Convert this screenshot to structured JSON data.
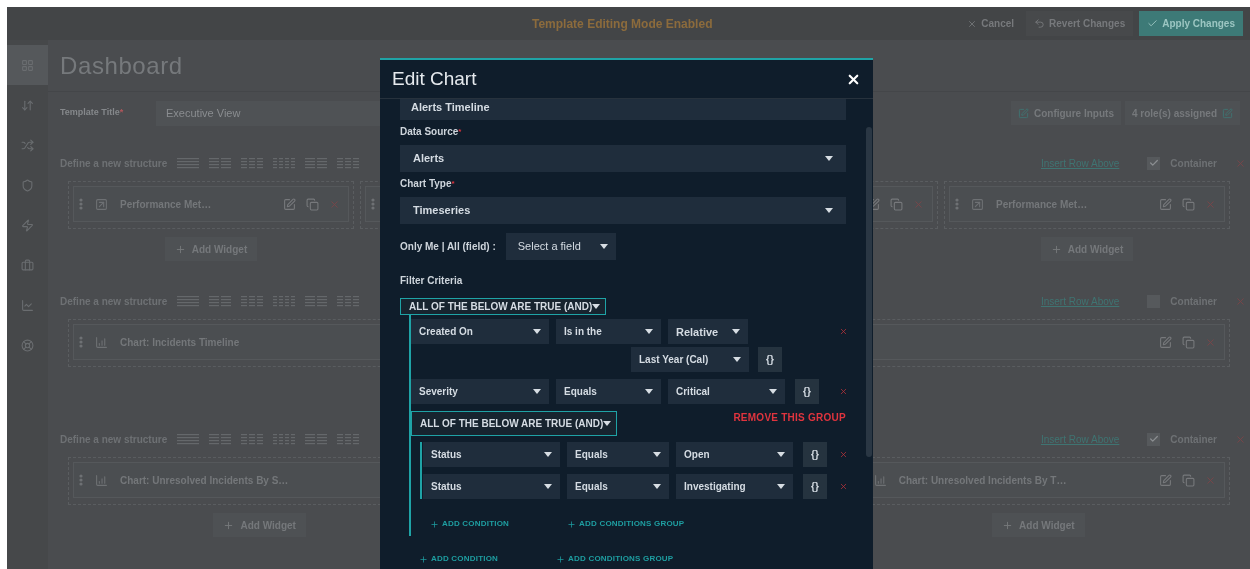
{
  "top_bar": {
    "title": "Template Editing Mode Enabled",
    "actions": [
      {
        "kind": "cancel",
        "label": "Cancel"
      },
      {
        "kind": "revert",
        "label": "Revert Changes"
      },
      {
        "kind": "apply",
        "label": "Apply Changes"
      }
    ]
  },
  "sidebar": {
    "items": [
      {
        "selected": true
      },
      {
        "selected": false
      },
      {
        "selected": false
      },
      {
        "selected": false
      },
      {
        "selected": false
      },
      {
        "selected": false
      },
      {
        "selected": false
      },
      {
        "selected": false
      }
    ]
  },
  "page_title": "Dashboard",
  "template_title": {
    "label": "Template Title",
    "required_mark": "*",
    "value": "Executive View"
  },
  "header_buttons": [
    {
      "kind": "icon_first",
      "label": "Configure Inputs"
    },
    {
      "kind": "icon_last",
      "label": "4 role(s) assigned"
    }
  ],
  "structures": [
    {
      "label": "Define a new structure",
      "insert_link": "Insert Row Above",
      "container_label": "Container",
      "container_checked": true,
      "columns": [
        {
          "widget": {
            "kind": "performance",
            "handle": true,
            "title": "Performance Met…",
            "actions": true
          },
          "add_widget": "Add Widget"
        },
        {
          "widget": {
            "handle": true
          }
        },
        {
          "widget": {
            "actions": true
          }
        },
        {
          "widget": {
            "kind": "performance",
            "handle": true,
            "title": "Performance Met…",
            "actions": true
          },
          "add_widget": "Add Widget"
        }
      ]
    },
    {
      "label": "Define a new structure",
      "insert_link": "Insert Row Above",
      "container_label": "Container",
      "container_checked": false,
      "columns": [
        {
          "widget": {
            "kind": "chart",
            "handle": true,
            "title": "Chart: Incidents Timeline",
            "actions": true
          }
        }
      ]
    },
    {
      "label": "Define a new structure",
      "insert_link": "Insert Row Above",
      "container_label": "Container",
      "container_checked": true,
      "columns": [
        {
          "widget": {
            "kind": "chart",
            "handle": true,
            "title": "Chart: Unresolved Incidents By S…",
            "actions": false
          },
          "add_widget": "Add Widget"
        },
        {},
        {
          "widget": {
            "kind": "chart",
            "handle": false,
            "title": "Chart: Unresolved Incidents By T…",
            "actions": true
          },
          "add_widget": "Add Widget"
        }
      ]
    }
  ],
  "modal": {
    "title": "Edit Chart",
    "fields": [
      {
        "kind": "text",
        "value": "Alerts Timeline"
      },
      {
        "kind": "select",
        "label": "Data Source",
        "required_mark": "*",
        "value": "Alerts"
      },
      {
        "kind": "select",
        "label": "Chart Type",
        "required_mark": "*",
        "value": "Timeseries"
      }
    ],
    "only_me": {
      "label": "Only Me | All (field) :",
      "value": "Select a field"
    },
    "filter": {
      "label": "Filter Criteria",
      "group": {
        "operator": "ALL OF THE BELOW ARE TRUE (AND)",
        "add_condition": "ADD CONDITION",
        "add_group": "ADD CONDITIONS GROUP",
        "children": [
          {
            "kind": "condition",
            "field": "Created On",
            "operator": "Is in the",
            "value": "Relative",
            "sub_value": "Last Year (Cal)",
            "variable_button": "{}"
          },
          {
            "kind": "condition",
            "field": "Severity",
            "operator": "Equals",
            "value": "Critical",
            "variable_button": "{}"
          },
          {
            "kind": "group",
            "operator": "ALL OF THE BELOW ARE TRUE (AND)",
            "remove_label": "REMOVE THIS GROUP",
            "add_condition": "ADD CONDITION",
            "add_group": "ADD CONDITIONS GROUP",
            "children": [
              {
                "kind": "condition",
                "field": "Status",
                "operator": "Equals",
                "value": "Open",
                "variable_button": "{}"
              },
              {
                "kind": "condition",
                "field": "Status",
                "operator": "Equals",
                "value": "Investigating",
                "variable_button": "{}"
              }
            ]
          }
        ]
      }
    }
  }
}
